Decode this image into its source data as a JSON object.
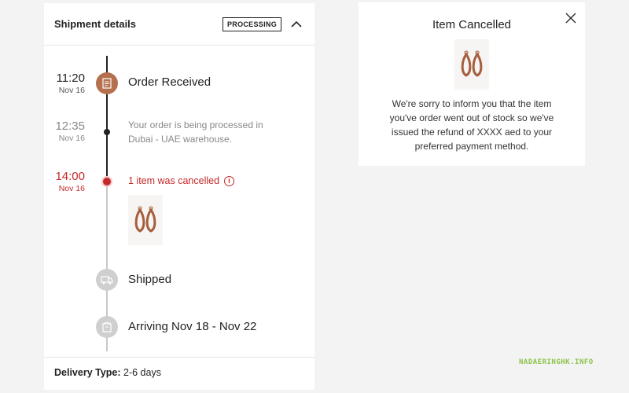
{
  "shipment": {
    "title": "Shipment details",
    "status_badge": "PROCESSING",
    "events": [
      {
        "time": "11:20",
        "date": "Nov 16",
        "label": "Order Received",
        "icon": "receipt-icon"
      },
      {
        "time": "12:35",
        "date": "Nov 16",
        "description": "Your order is being processed in Dubai - UAE warehouse."
      },
      {
        "time": "14:00",
        "date": "Nov 16",
        "label": "1 item was cancelled",
        "icon": "info-icon"
      },
      {
        "label": "Shipped",
        "icon": "truck-icon"
      },
      {
        "label": "Arriving Nov 18 - Nov 22",
        "icon": "package-icon"
      }
    ],
    "delivery_type_label": "Delivery Type:",
    "delivery_type_value": "2-6 days"
  },
  "cancel_modal": {
    "title": "Item Cancelled",
    "message": "We're sorry to inform you that the item you've order went out of stock so we've issued the refund of XXXX aed to your preferred payment method."
  },
  "watermark": "NADAERINGHK.INFO",
  "colors": {
    "accent_brown": "#b4704f",
    "cancel_red": "#c62828",
    "timeline_dark": "#222222",
    "timeline_gray": "#c8c8c8"
  }
}
